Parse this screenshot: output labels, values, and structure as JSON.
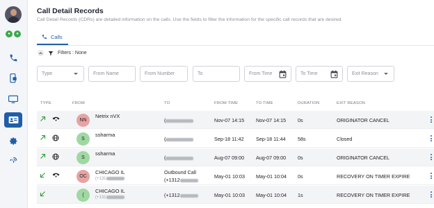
{
  "colors": {
    "accent": "#1f5ea8",
    "green_arrow": "#2e9e3a",
    "avatar_pink": "#e7a3a3",
    "avatar_green": "#9fd8a2",
    "status_green": "#3aa84a"
  },
  "sidebar": {
    "items": [
      {
        "icon": "phone-icon",
        "active": false
      },
      {
        "icon": "mobile-device-icon",
        "active": false
      },
      {
        "icon": "monitor-icon",
        "active": false
      },
      {
        "icon": "contact-card-icon",
        "active": true
      },
      {
        "icon": "gear-icon",
        "active": false
      },
      {
        "icon": "fingerprint-icon",
        "active": false
      }
    ]
  },
  "header": {
    "title": "Call Detail Records",
    "subtitle": "Call Detail Records (CDRs) are detailed information on the calls. Use the fields to filter the information for the specific call records that are desired."
  },
  "tabs": [
    {
      "label": "Calls",
      "active": true
    }
  ],
  "filters": {
    "summary": "Filters : None",
    "type_placeholder": "Type",
    "from_name_placeholder": "From Name",
    "from_number_placeholder": "From Number",
    "to_placeholder": "To",
    "from_time_placeholder": "From Time",
    "to_time_placeholder": "To Time",
    "exit_reason_placeholder": "Exit Reason"
  },
  "table": {
    "columns": [
      "TYPE",
      "FROM",
      "TO",
      "FROM TIME",
      "TO TIME",
      "DURATION",
      "EXIT REASON"
    ],
    "rows": [
      {
        "direction": "outgoing",
        "call_type": "phone-handset-icon",
        "initials": "NN",
        "avatar_color": "pink",
        "from_name": "Netrix nVX",
        "from_number": "",
        "to_label": "",
        "to_number": "(",
        "from_time": "Nov-07 14:15",
        "to_time": "Nov-07 14:15",
        "duration": "0s",
        "exit_reason": "ORIGINATOR CANCEL"
      },
      {
        "direction": "outgoing",
        "call_type": "globe-icon",
        "initials": "S",
        "avatar_color": "green",
        "from_name": "ssharma",
        "from_number": "",
        "to_label": "",
        "to_number": "(",
        "from_time": "Sep-18 11:42",
        "to_time": "Sep-18 11:44",
        "duration": "58s",
        "exit_reason": "Closed"
      },
      {
        "direction": "outgoing",
        "call_type": "globe-icon",
        "initials": "S",
        "avatar_color": "green",
        "from_name": "ssharma",
        "from_number": "",
        "to_label": "",
        "to_number": "(",
        "from_time": "Aug-07 09:00",
        "to_time": "Aug-07 09:00",
        "duration": "0s",
        "exit_reason": "ORIGINATOR CANCEL"
      },
      {
        "direction": "incoming",
        "call_type": "phone-handset-icon",
        "initials": "OC",
        "avatar_color": "pink",
        "from_name": "CHICAGO IL",
        "from_number": "(+131",
        "to_label": "Outbound Call",
        "to_number": "(+1312",
        "from_time": "May-01 10:03",
        "to_time": "May-01 10:04",
        "duration": "0s",
        "exit_reason": "RECOVERY ON TIMER EXPIRE"
      },
      {
        "direction": "incoming",
        "call_type": "",
        "initials": "(",
        "avatar_color": "green",
        "from_name": "CHICAGO IL",
        "from_number": "(+131",
        "to_label": "",
        "to_number": "(+1312",
        "from_time": "May-01 10:03",
        "to_time": "May-01 10:04",
        "duration": "1s",
        "exit_reason": "RECOVERY ON TIMER EXPIRE"
      }
    ]
  }
}
